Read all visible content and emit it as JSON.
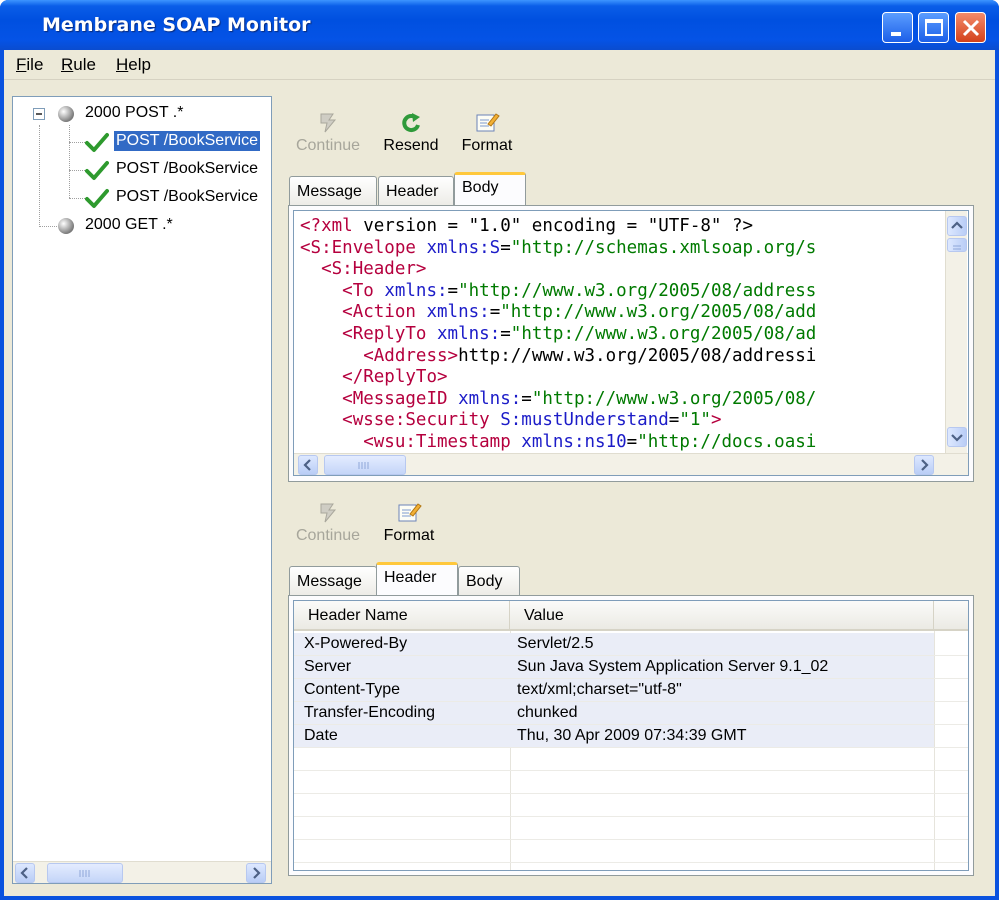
{
  "window": {
    "title": "Membrane SOAP Monitor"
  },
  "menu": {
    "items": [
      {
        "label": "File"
      },
      {
        "label": "Rule"
      },
      {
        "label": "Help"
      }
    ]
  },
  "tree": {
    "nodes": [
      {
        "label": "2000 POST .*"
      },
      {
        "label": "POST /BookService"
      },
      {
        "label": "POST /BookService"
      },
      {
        "label": "POST /BookService"
      },
      {
        "label": "2000 GET .*"
      }
    ]
  },
  "request": {
    "toolbar": {
      "continue_label": "Continue",
      "resend_label": "Resend",
      "format_label": "Format"
    },
    "tabs": [
      {
        "label": "Message"
      },
      {
        "label": "Header"
      },
      {
        "label": "Body"
      }
    ],
    "active_tab": "Body",
    "code_lines": [
      "<?xml version = \"1.0\" encoding = \"UTF-8\" ?>",
      "<S:Envelope xmlns:S=\"http://schemas.xmlsoap.org/s",
      "  <S:Header>",
      "    <To xmlns:=\"http://www.w3.org/2005/08/address",
      "    <Action xmlns:=\"http://www.w3.org/2005/08/add",
      "    <ReplyTo xmlns:=\"http://www.w3.org/2005/08/ad",
      "      <Address>http://www.w3.org/2005/08/addressi",
      "    </ReplyTo>",
      "    <MessageID xmlns:=\"http://www.w3.org/2005/08/",
      "    <wsse:Security S:mustUnderstand=\"1\">",
      "      <wsu:Timestamp xmlns:ns10=\"http://docs.oasi"
    ]
  },
  "response": {
    "toolbar": {
      "continue_label": "Continue",
      "format_label": "Format"
    },
    "tabs": [
      {
        "label": "Message"
      },
      {
        "label": "Header"
      },
      {
        "label": "Body"
      }
    ],
    "active_tab": "Header",
    "columns": {
      "name": "Header Name",
      "value": "Value"
    },
    "headers": [
      {
        "name": "X-Powered-By",
        "value": "Servlet/2.5"
      },
      {
        "name": "Server",
        "value": "Sun Java System Application Server 9.1_02"
      },
      {
        "name": "Content-Type",
        "value": "text/xml;charset=\"utf-8\""
      },
      {
        "name": "Transfer-Encoding",
        "value": "chunked"
      },
      {
        "name": "Date",
        "value": "Thu, 30 Apr 2009 07:34:39 GMT"
      }
    ]
  },
  "colors": {
    "titlebar": "#0553e6",
    "window_bg": "#ece9d8",
    "selection": "#316ac5",
    "active_tab_accent": "#ffc83c",
    "xml_tag": "#b5003e",
    "xml_attr": "#1c1cc8",
    "xml_value": "#007a00"
  }
}
